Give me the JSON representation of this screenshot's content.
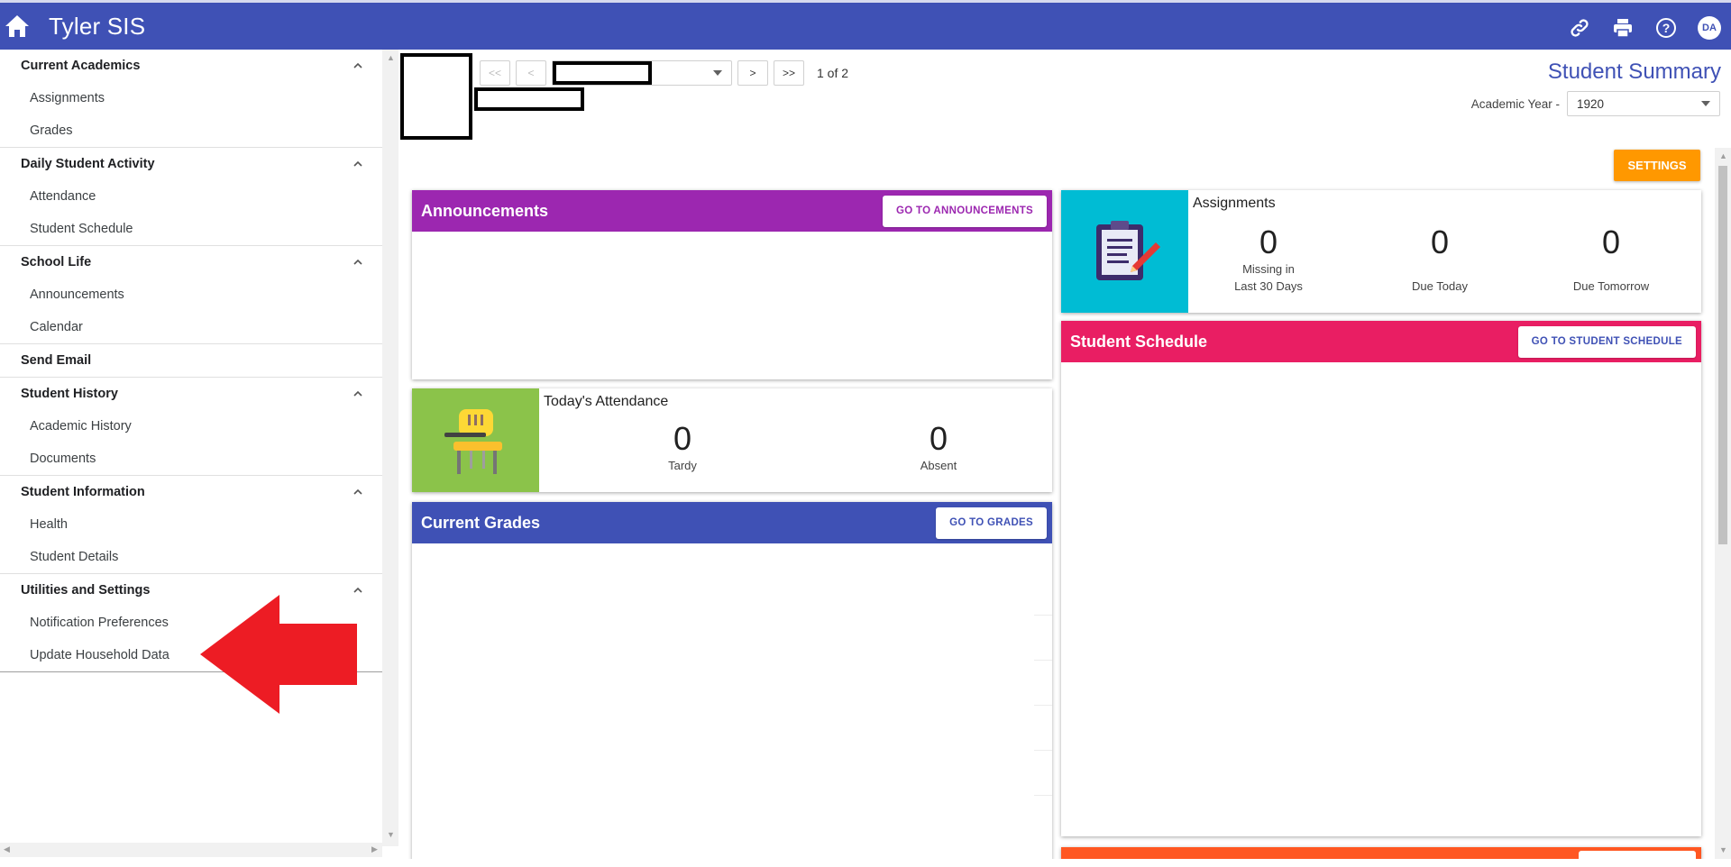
{
  "app": {
    "title": "Tyler SIS",
    "user_initials": "DA"
  },
  "sidebar": {
    "sections": [
      {
        "header": "Current Academics",
        "items": [
          "Assignments",
          "Grades"
        ]
      },
      {
        "header": "Daily Student Activity",
        "items": [
          "Attendance",
          "Student Schedule"
        ]
      },
      {
        "header": "School Life",
        "items": [
          "Announcements",
          "Calendar"
        ]
      },
      {
        "header": "Send Email",
        "items": []
      },
      {
        "header": "Student History",
        "items": [
          "Academic History",
          "Documents"
        ]
      },
      {
        "header": "Student Information",
        "items": [
          "Health",
          "Student Details"
        ]
      },
      {
        "header": "Utilities and Settings",
        "items": [
          "Notification Preferences",
          "Update Household Data"
        ]
      }
    ]
  },
  "pager": {
    "first": "<<",
    "prev": "<",
    "next": ">",
    "last": ">>",
    "count": "1 of 2"
  },
  "header": {
    "title": "Student Summary",
    "year_label": "Academic Year -",
    "year_value": "1920",
    "settings_label": "SETTINGS"
  },
  "announcements": {
    "title": "Announcements",
    "button": "GO TO ANNOUNCEMENTS"
  },
  "attendance": {
    "title": "Today's Attendance",
    "tardy_value": "0",
    "tardy_label": "Tardy",
    "absent_value": "0",
    "absent_label": "Absent"
  },
  "grades": {
    "title": "Current Grades",
    "button": "GO TO GRADES"
  },
  "assignments": {
    "title": "Assignments",
    "missing_value": "0",
    "missing_label_1": "Missing in",
    "missing_label_2": "Last 30 Days",
    "today_value": "0",
    "today_label": "Due Today",
    "tomorrow_value": "0",
    "tomorrow_label": "Due Tomorrow"
  },
  "schedule": {
    "title": "Student Schedule",
    "button": "GO TO STUDENT SCHEDULE"
  },
  "colors": {
    "primary": "#3f51b5",
    "announcements": "#9c27b0",
    "schedule": "#e91e63",
    "attendance_tile": "#8bc34a",
    "assignments_tile": "#00bcd4",
    "settings": "#ff9800",
    "bottom_card": "#ff5722",
    "arrow": "#ed1c24"
  },
  "icons": [
    "home-icon",
    "link-icon",
    "print-icon",
    "help-icon",
    "chevron-up-icon",
    "chair-icon",
    "clipboard-icon"
  ]
}
